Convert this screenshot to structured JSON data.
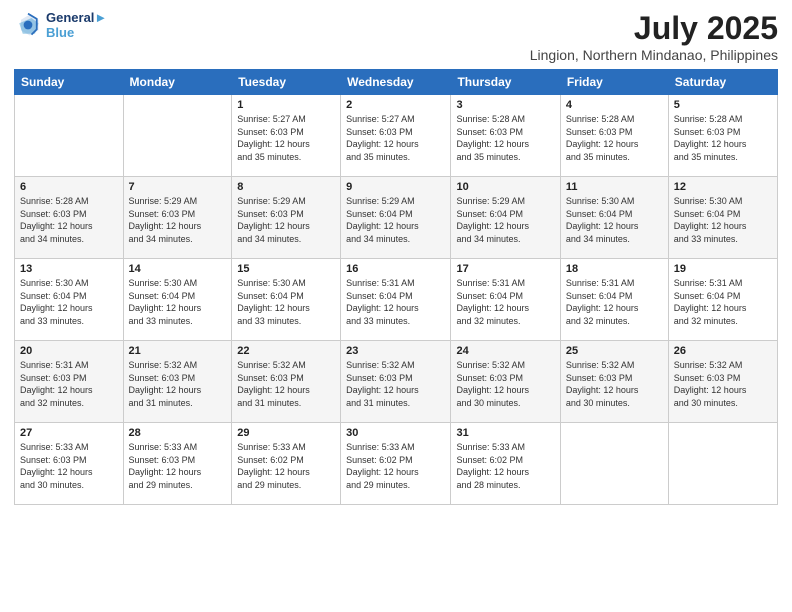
{
  "header": {
    "logo_line1": "General",
    "logo_line2": "Blue",
    "title": "July 2025",
    "subtitle": "Lingion, Northern Mindanao, Philippines"
  },
  "calendar": {
    "days_of_week": [
      "Sunday",
      "Monday",
      "Tuesday",
      "Wednesday",
      "Thursday",
      "Friday",
      "Saturday"
    ],
    "weeks": [
      [
        {
          "day": "",
          "content": ""
        },
        {
          "day": "",
          "content": ""
        },
        {
          "day": "1",
          "content": "Sunrise: 5:27 AM\nSunset: 6:03 PM\nDaylight: 12 hours\nand 35 minutes."
        },
        {
          "day": "2",
          "content": "Sunrise: 5:27 AM\nSunset: 6:03 PM\nDaylight: 12 hours\nand 35 minutes."
        },
        {
          "day": "3",
          "content": "Sunrise: 5:28 AM\nSunset: 6:03 PM\nDaylight: 12 hours\nand 35 minutes."
        },
        {
          "day": "4",
          "content": "Sunrise: 5:28 AM\nSunset: 6:03 PM\nDaylight: 12 hours\nand 35 minutes."
        },
        {
          "day": "5",
          "content": "Sunrise: 5:28 AM\nSunset: 6:03 PM\nDaylight: 12 hours\nand 35 minutes."
        }
      ],
      [
        {
          "day": "6",
          "content": "Sunrise: 5:28 AM\nSunset: 6:03 PM\nDaylight: 12 hours\nand 34 minutes."
        },
        {
          "day": "7",
          "content": "Sunrise: 5:29 AM\nSunset: 6:03 PM\nDaylight: 12 hours\nand 34 minutes."
        },
        {
          "day": "8",
          "content": "Sunrise: 5:29 AM\nSunset: 6:03 PM\nDaylight: 12 hours\nand 34 minutes."
        },
        {
          "day": "9",
          "content": "Sunrise: 5:29 AM\nSunset: 6:04 PM\nDaylight: 12 hours\nand 34 minutes."
        },
        {
          "day": "10",
          "content": "Sunrise: 5:29 AM\nSunset: 6:04 PM\nDaylight: 12 hours\nand 34 minutes."
        },
        {
          "day": "11",
          "content": "Sunrise: 5:30 AM\nSunset: 6:04 PM\nDaylight: 12 hours\nand 34 minutes."
        },
        {
          "day": "12",
          "content": "Sunrise: 5:30 AM\nSunset: 6:04 PM\nDaylight: 12 hours\nand 33 minutes."
        }
      ],
      [
        {
          "day": "13",
          "content": "Sunrise: 5:30 AM\nSunset: 6:04 PM\nDaylight: 12 hours\nand 33 minutes."
        },
        {
          "day": "14",
          "content": "Sunrise: 5:30 AM\nSunset: 6:04 PM\nDaylight: 12 hours\nand 33 minutes."
        },
        {
          "day": "15",
          "content": "Sunrise: 5:30 AM\nSunset: 6:04 PM\nDaylight: 12 hours\nand 33 minutes."
        },
        {
          "day": "16",
          "content": "Sunrise: 5:31 AM\nSunset: 6:04 PM\nDaylight: 12 hours\nand 33 minutes."
        },
        {
          "day": "17",
          "content": "Sunrise: 5:31 AM\nSunset: 6:04 PM\nDaylight: 12 hours\nand 32 minutes."
        },
        {
          "day": "18",
          "content": "Sunrise: 5:31 AM\nSunset: 6:04 PM\nDaylight: 12 hours\nand 32 minutes."
        },
        {
          "day": "19",
          "content": "Sunrise: 5:31 AM\nSunset: 6:04 PM\nDaylight: 12 hours\nand 32 minutes."
        }
      ],
      [
        {
          "day": "20",
          "content": "Sunrise: 5:31 AM\nSunset: 6:03 PM\nDaylight: 12 hours\nand 32 minutes."
        },
        {
          "day": "21",
          "content": "Sunrise: 5:32 AM\nSunset: 6:03 PM\nDaylight: 12 hours\nand 31 minutes."
        },
        {
          "day": "22",
          "content": "Sunrise: 5:32 AM\nSunset: 6:03 PM\nDaylight: 12 hours\nand 31 minutes."
        },
        {
          "day": "23",
          "content": "Sunrise: 5:32 AM\nSunset: 6:03 PM\nDaylight: 12 hours\nand 31 minutes."
        },
        {
          "day": "24",
          "content": "Sunrise: 5:32 AM\nSunset: 6:03 PM\nDaylight: 12 hours\nand 30 minutes."
        },
        {
          "day": "25",
          "content": "Sunrise: 5:32 AM\nSunset: 6:03 PM\nDaylight: 12 hours\nand 30 minutes."
        },
        {
          "day": "26",
          "content": "Sunrise: 5:32 AM\nSunset: 6:03 PM\nDaylight: 12 hours\nand 30 minutes."
        }
      ],
      [
        {
          "day": "27",
          "content": "Sunrise: 5:33 AM\nSunset: 6:03 PM\nDaylight: 12 hours\nand 30 minutes."
        },
        {
          "day": "28",
          "content": "Sunrise: 5:33 AM\nSunset: 6:03 PM\nDaylight: 12 hours\nand 29 minutes."
        },
        {
          "day": "29",
          "content": "Sunrise: 5:33 AM\nSunset: 6:02 PM\nDaylight: 12 hours\nand 29 minutes."
        },
        {
          "day": "30",
          "content": "Sunrise: 5:33 AM\nSunset: 6:02 PM\nDaylight: 12 hours\nand 29 minutes."
        },
        {
          "day": "31",
          "content": "Sunrise: 5:33 AM\nSunset: 6:02 PM\nDaylight: 12 hours\nand 28 minutes."
        },
        {
          "day": "",
          "content": ""
        },
        {
          "day": "",
          "content": ""
        }
      ]
    ]
  }
}
